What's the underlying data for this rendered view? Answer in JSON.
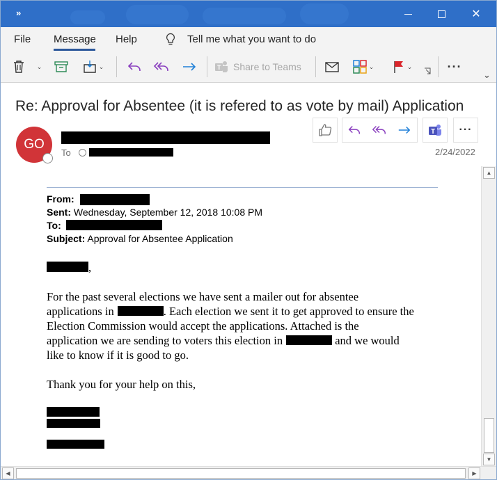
{
  "window": {
    "expand_glyph": "»",
    "controls": {
      "minimize": "minimize-icon",
      "maximize": "maximize-icon",
      "close": "✕"
    }
  },
  "menu": {
    "file": "File",
    "message": "Message",
    "help": "Help",
    "tell_me": "Tell me what you want to do"
  },
  "ribbon": {
    "share_to_teams": "Share to Teams",
    "more": "···",
    "icons": [
      "delete-icon",
      "archive-icon",
      "move-icon",
      "reply-icon",
      "reply-all-icon",
      "forward-icon",
      "teams-share-icon",
      "mark-unread-icon",
      "categorize-icon",
      "flag-icon",
      "more-icon"
    ]
  },
  "email": {
    "subject": "Re: Approval for Absentee (it is refered to as vote by mail) Application",
    "avatar_initials": "GO",
    "avatar_color": "#d13438",
    "to_label": "To",
    "date": "2/24/2022",
    "more": "···"
  },
  "forwarded": {
    "from_label": "From:",
    "sent_label": "Sent:",
    "sent_value": "Wednesday, September 12, 2018 10:08 PM",
    "to_label": "To:",
    "subject_label": "Subject:",
    "subject_value": "Approval for Absentee Application"
  },
  "body": {
    "greeting_suffix": ",",
    "p1_line1": "For the past several elections we have sent a mailer out for absentee",
    "p1_line2_a": "applications in",
    "p1_line2_b": ". Each election we sent it to get approved to ensure the",
    "p1_line3": "Election Commission would accept the applications. Attached is the",
    "p1_line4_a": "application we are sending to voters this election in",
    "p1_line4_b": " and we would",
    "p1_line5": "like to know if it is good to go.",
    "thanks": "Thank you for your help on this,"
  },
  "colors": {
    "titlebar": "#2f6fc8",
    "accent": "#2b579a",
    "reply_purple": "#8a3fbf",
    "forward_blue": "#1e7fd8",
    "flag_red": "#d9262c"
  }
}
